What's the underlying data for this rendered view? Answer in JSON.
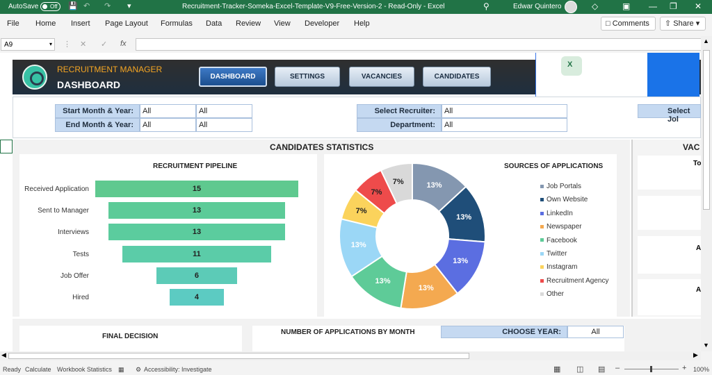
{
  "titlebar": {
    "autosave_label": "AutoSave",
    "autosave_state": "Off",
    "doc_title": "Recruitment-Tracker-Someka-Excel-Template-V9-Free-Version-2  -  Read-Only  -  Excel",
    "user_name": "Edwar Quintero"
  },
  "menu": {
    "items": [
      "File",
      "Home",
      "Insert",
      "Page Layout",
      "Formulas",
      "Data",
      "Review",
      "View",
      "Developer",
      "Help"
    ],
    "comments_label": "Comments",
    "share_label": "Share"
  },
  "formula_bar": {
    "name_box": "A9",
    "formula": ""
  },
  "header": {
    "app_name": "RECRUITMENT MANAGER",
    "page_name": "DASHBOARD",
    "nav": [
      "DASHBOARD",
      "SETTINGS",
      "VACANCIES",
      "CANDIDATES"
    ],
    "active_nav": "DASHBOARD"
  },
  "filters": {
    "start_label": "Start Month & Year:",
    "start_month": "All",
    "start_year": "All",
    "end_label": "End Month & Year:",
    "end_month": "All",
    "end_year": "All",
    "recruiter_label": "Select Recruiter:",
    "recruiter_value": "All",
    "department_label": "Department:",
    "department_value": "All",
    "job_label": "Select Jol"
  },
  "candidates_statistics": {
    "title": "CANDIDATES STATISTICS"
  },
  "right_panel": {
    "title": "VAC",
    "labels": [
      "To",
      "A",
      "A"
    ]
  },
  "pipeline": {
    "title": "RECRUITMENT PIPELINE",
    "stages": [
      {
        "label": "Received Application",
        "value": 15,
        "color": "#5fc98f"
      },
      {
        "label": "Sent to Manager",
        "value": 13,
        "color": "#5ccb98"
      },
      {
        "label": "Interviews",
        "value": 13,
        "color": "#5bcc9e"
      },
      {
        "label": "Tests",
        "value": 11,
        "color": "#5bcca8"
      },
      {
        "label": "Job Offer",
        "value": 6,
        "color": "#5ccbb7"
      },
      {
        "label": "Hired",
        "value": 4,
        "color": "#5ccbc2"
      }
    ]
  },
  "chart_data": {
    "type": "pie",
    "title": "SOURCES OF APPLICATIONS",
    "categories": [
      "Job Portals",
      "Own Website",
      "LinkedIn",
      "Newspaper",
      "Facebook",
      "Twitter",
      "Instagram",
      "Recruitment Agency",
      "Other"
    ],
    "values": [
      13,
      13,
      13,
      13,
      13,
      13,
      7,
      7,
      7
    ],
    "value_labels": [
      "13%",
      "13%",
      "13%",
      "13%",
      "13%",
      "13%",
      "7%",
      "7%",
      "7%"
    ],
    "colors": [
      "#8497b0",
      "#1f4e79",
      "#5b6ee1",
      "#f4a950",
      "#5ecb98",
      "#9bd7f6",
      "#fbd35c",
      "#ee4b4b",
      "#d9d9d9"
    ],
    "donut": true,
    "legend": "right"
  },
  "final_decision": {
    "title": "FINAL DECISION"
  },
  "applications_by_month": {
    "title": "NUMBER OF APPLICATIONS BY MONTH",
    "year_label": "CHOOSE YEAR:",
    "year_value": "All"
  },
  "statusbar": {
    "ready": "Ready",
    "calculate": "Calculate",
    "workbook_stats": "Workbook Statistics",
    "accessibility": "Accessibility: Investigate",
    "zoom": "100%"
  }
}
